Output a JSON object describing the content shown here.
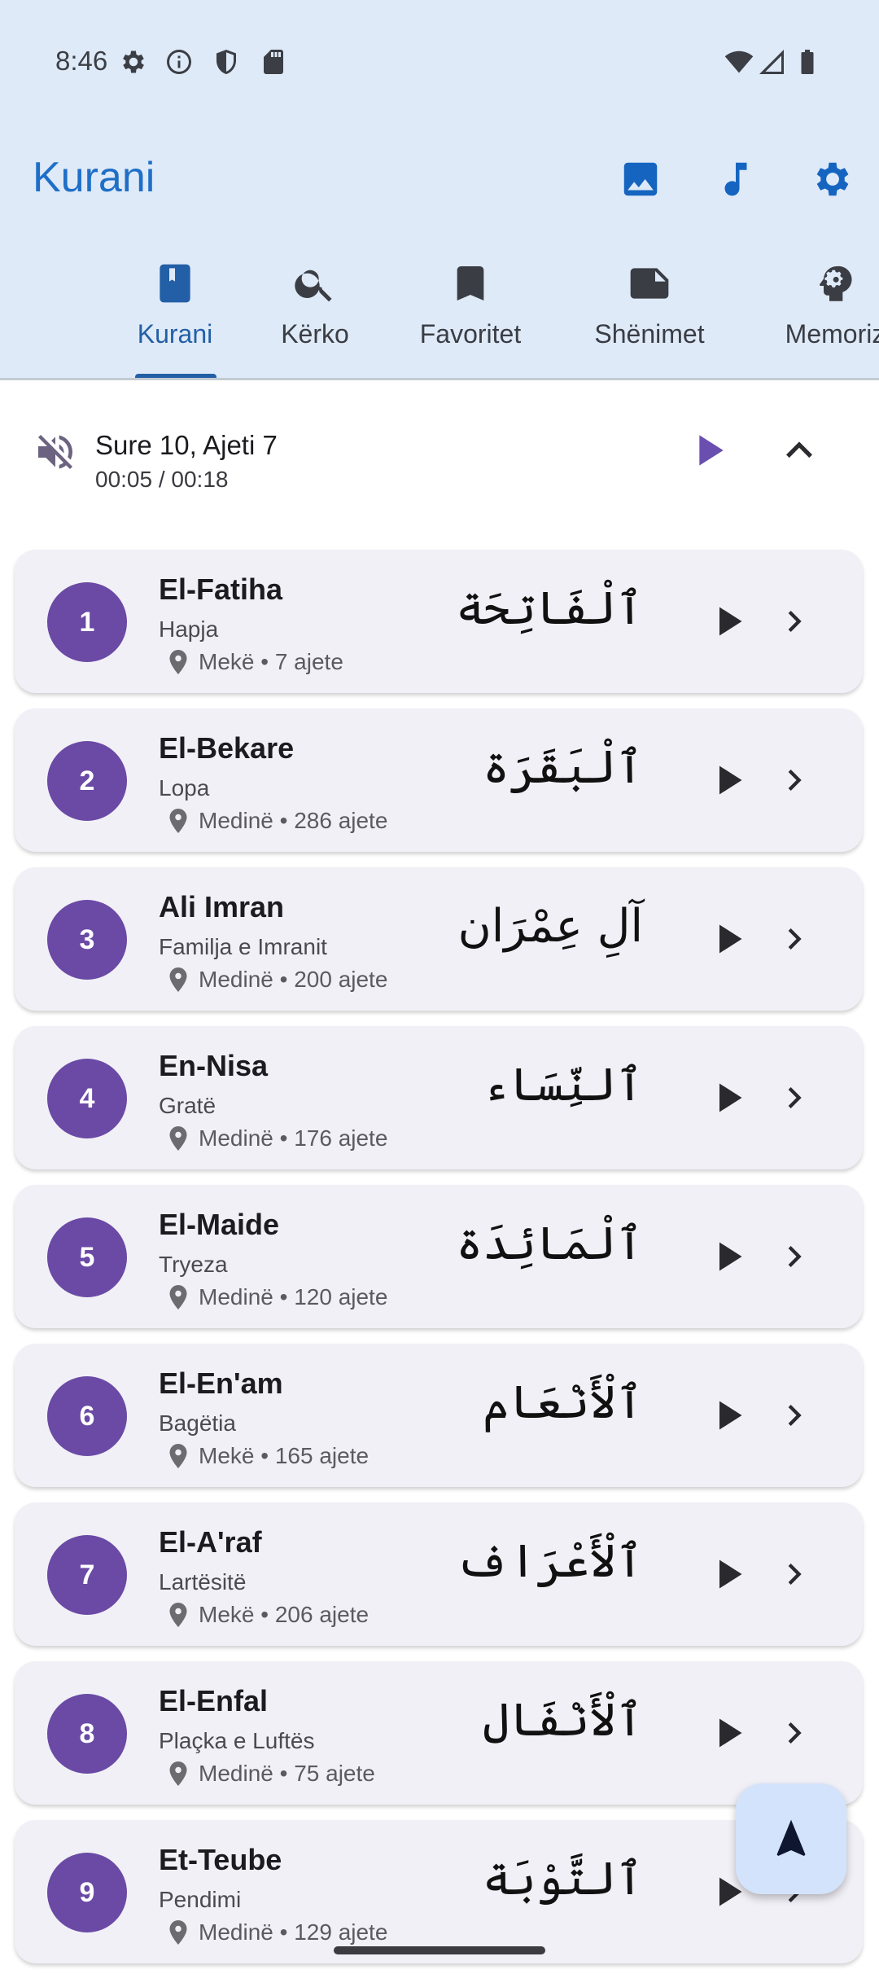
{
  "status_bar": {
    "time": "8:46",
    "left_icons": [
      "settings-icon",
      "info-icon",
      "shield-icon",
      "sd-card-icon"
    ],
    "right_icons": [
      "wifi-icon",
      "signal-icon",
      "battery-icon"
    ]
  },
  "app_bar": {
    "title": "Kurani",
    "actions": [
      "image-icon",
      "music-note-icon",
      "settings-icon"
    ]
  },
  "tabs": [
    {
      "label": "Kurani",
      "icon": "book-icon",
      "active": true
    },
    {
      "label": "Kërko",
      "icon": "search-icon",
      "active": false
    },
    {
      "label": "Favoritet",
      "icon": "bookmark-icon",
      "active": false
    },
    {
      "label": "Shënimet",
      "icon": "note-icon",
      "active": false
    },
    {
      "label": "Memoriz",
      "icon": "psychology-icon",
      "active": false
    }
  ],
  "player": {
    "title": "Sure 10, Ajeti 7",
    "time": "00:05 / 00:18",
    "mute_icon": "volume-off-icon",
    "play_icon": "play-icon",
    "collapse_icon": "chevron-up-icon"
  },
  "surahs": [
    {
      "number": "1",
      "name": "El-Fatiha",
      "meaning": "Hapja",
      "info": "Mekë • 7 ajete",
      "arabic": "ٱلْفَاتِحَة"
    },
    {
      "number": "2",
      "name": "El-Bekare",
      "meaning": "Lopa",
      "info": "Medinë • 286 ajete",
      "arabic": "ٱلْبَقَرَة"
    },
    {
      "number": "3",
      "name": "Ali Imran",
      "meaning": "Familja e Imranit",
      "info": "Medinë • 200 ajete",
      "arabic": "آلِ عِمْرَان"
    },
    {
      "number": "4",
      "name": "En-Nisa",
      "meaning": "Gratë",
      "info": "Medinë • 176 ajete",
      "arabic": "ٱلنِّسَاء"
    },
    {
      "number": "5",
      "name": "El-Maide",
      "meaning": "Tryeza",
      "info": "Medinë • 120 ajete",
      "arabic": "ٱلْمَائِدَة"
    },
    {
      "number": "6",
      "name": "El-En'am",
      "meaning": "Bagëtia",
      "info": "Mekë • 165 ajete",
      "arabic": "ٱلْأَنْعَام"
    },
    {
      "number": "7",
      "name": "El-A'raf",
      "meaning": "Lartësitë",
      "info": "Mekë • 206 ajete",
      "arabic": "ٱلْأَعْرَاف"
    },
    {
      "number": "8",
      "name": "El-Enfal",
      "meaning": "Plaçka e Luftës",
      "info": "Medinë • 75 ajete",
      "arabic": "ٱلْأَنْفَال"
    },
    {
      "number": "9",
      "name": "Et-Teube",
      "meaning": "Pendimi",
      "info": "Medinë • 129 ajete",
      "arabic": "ٱلتَّوْبَة"
    }
  ],
  "fab": {
    "icon": "navigation-arrow-icon"
  },
  "colors": {
    "header_bg": "#dfeaf8",
    "accent_blue": "#235fa6",
    "badge_purple": "#6a4aa5",
    "card_bg": "#f1f0f7",
    "fab_bg": "#d3e3fb"
  }
}
